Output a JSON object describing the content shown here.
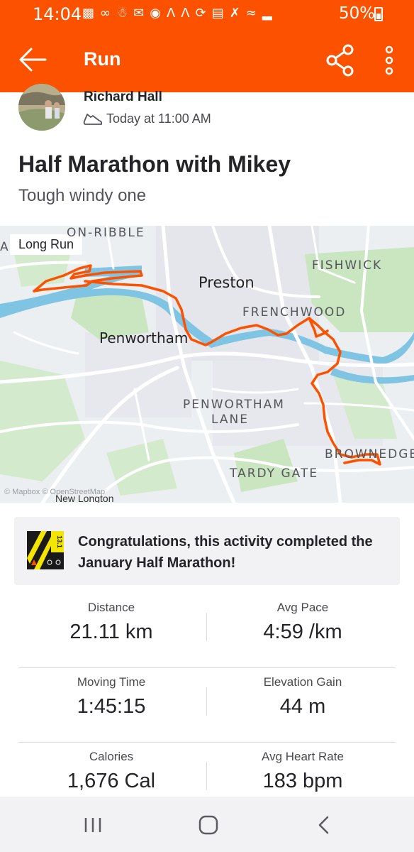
{
  "status_bar": {
    "time": "14:04",
    "battery": "50%",
    "icons": [
      "message-icon",
      "voicemail-icon",
      "ghost-icon",
      "mail-icon",
      "app-icon",
      "strava-icon",
      "strava-icon",
      "sync-icon",
      "calendar-icon",
      "mute-icon",
      "wifi-icon",
      "signal-icon"
    ]
  },
  "app_bar": {
    "title": "Run"
  },
  "activity": {
    "athlete": "Richard Hall",
    "when": "Today at 11:00 AM",
    "title": "Half Marathon with Mikey",
    "description": "Tough windy one"
  },
  "map": {
    "tag": "Long Run",
    "labels": {
      "on_ribble": "ON-RIBBLE",
      "fishwick": "FISHWICK",
      "preston": "Preston",
      "frenchwood": "FRENCHWOOD",
      "penwortham": "Penwortham",
      "penwortham_lane_1": "PENWORTHAM",
      "penwortham_lane_2": "LANE",
      "brownedge": "BROWNEDGE",
      "tardy_gate": "TARDY GATE",
      "new_longton": "New Longton",
      "left_edge": "A"
    },
    "attribution": "© Mapbox © OpenStreetMap",
    "route_color": "#fc5200"
  },
  "achievement": {
    "badge_text": "13.1",
    "text": "Congratulations, this activity completed the January Half Marathon!"
  },
  "stats": [
    {
      "left_label": "Distance",
      "left_value": "21.11 km",
      "right_label": "Avg Pace",
      "right_value": "4:59 /km"
    },
    {
      "left_label": "Moving Time",
      "left_value": "1:45:15",
      "right_label": "Elevation Gain",
      "right_value": "44 m"
    },
    {
      "left_label": "Calories",
      "left_value": "1,676 Cal",
      "right_label": "Avg Heart Rate",
      "right_value": "183 bpm"
    }
  ],
  "colors": {
    "brand": "#fc5200",
    "water": "#7fc4e3",
    "park": "#c9e6c0",
    "road": "#ffffff"
  }
}
